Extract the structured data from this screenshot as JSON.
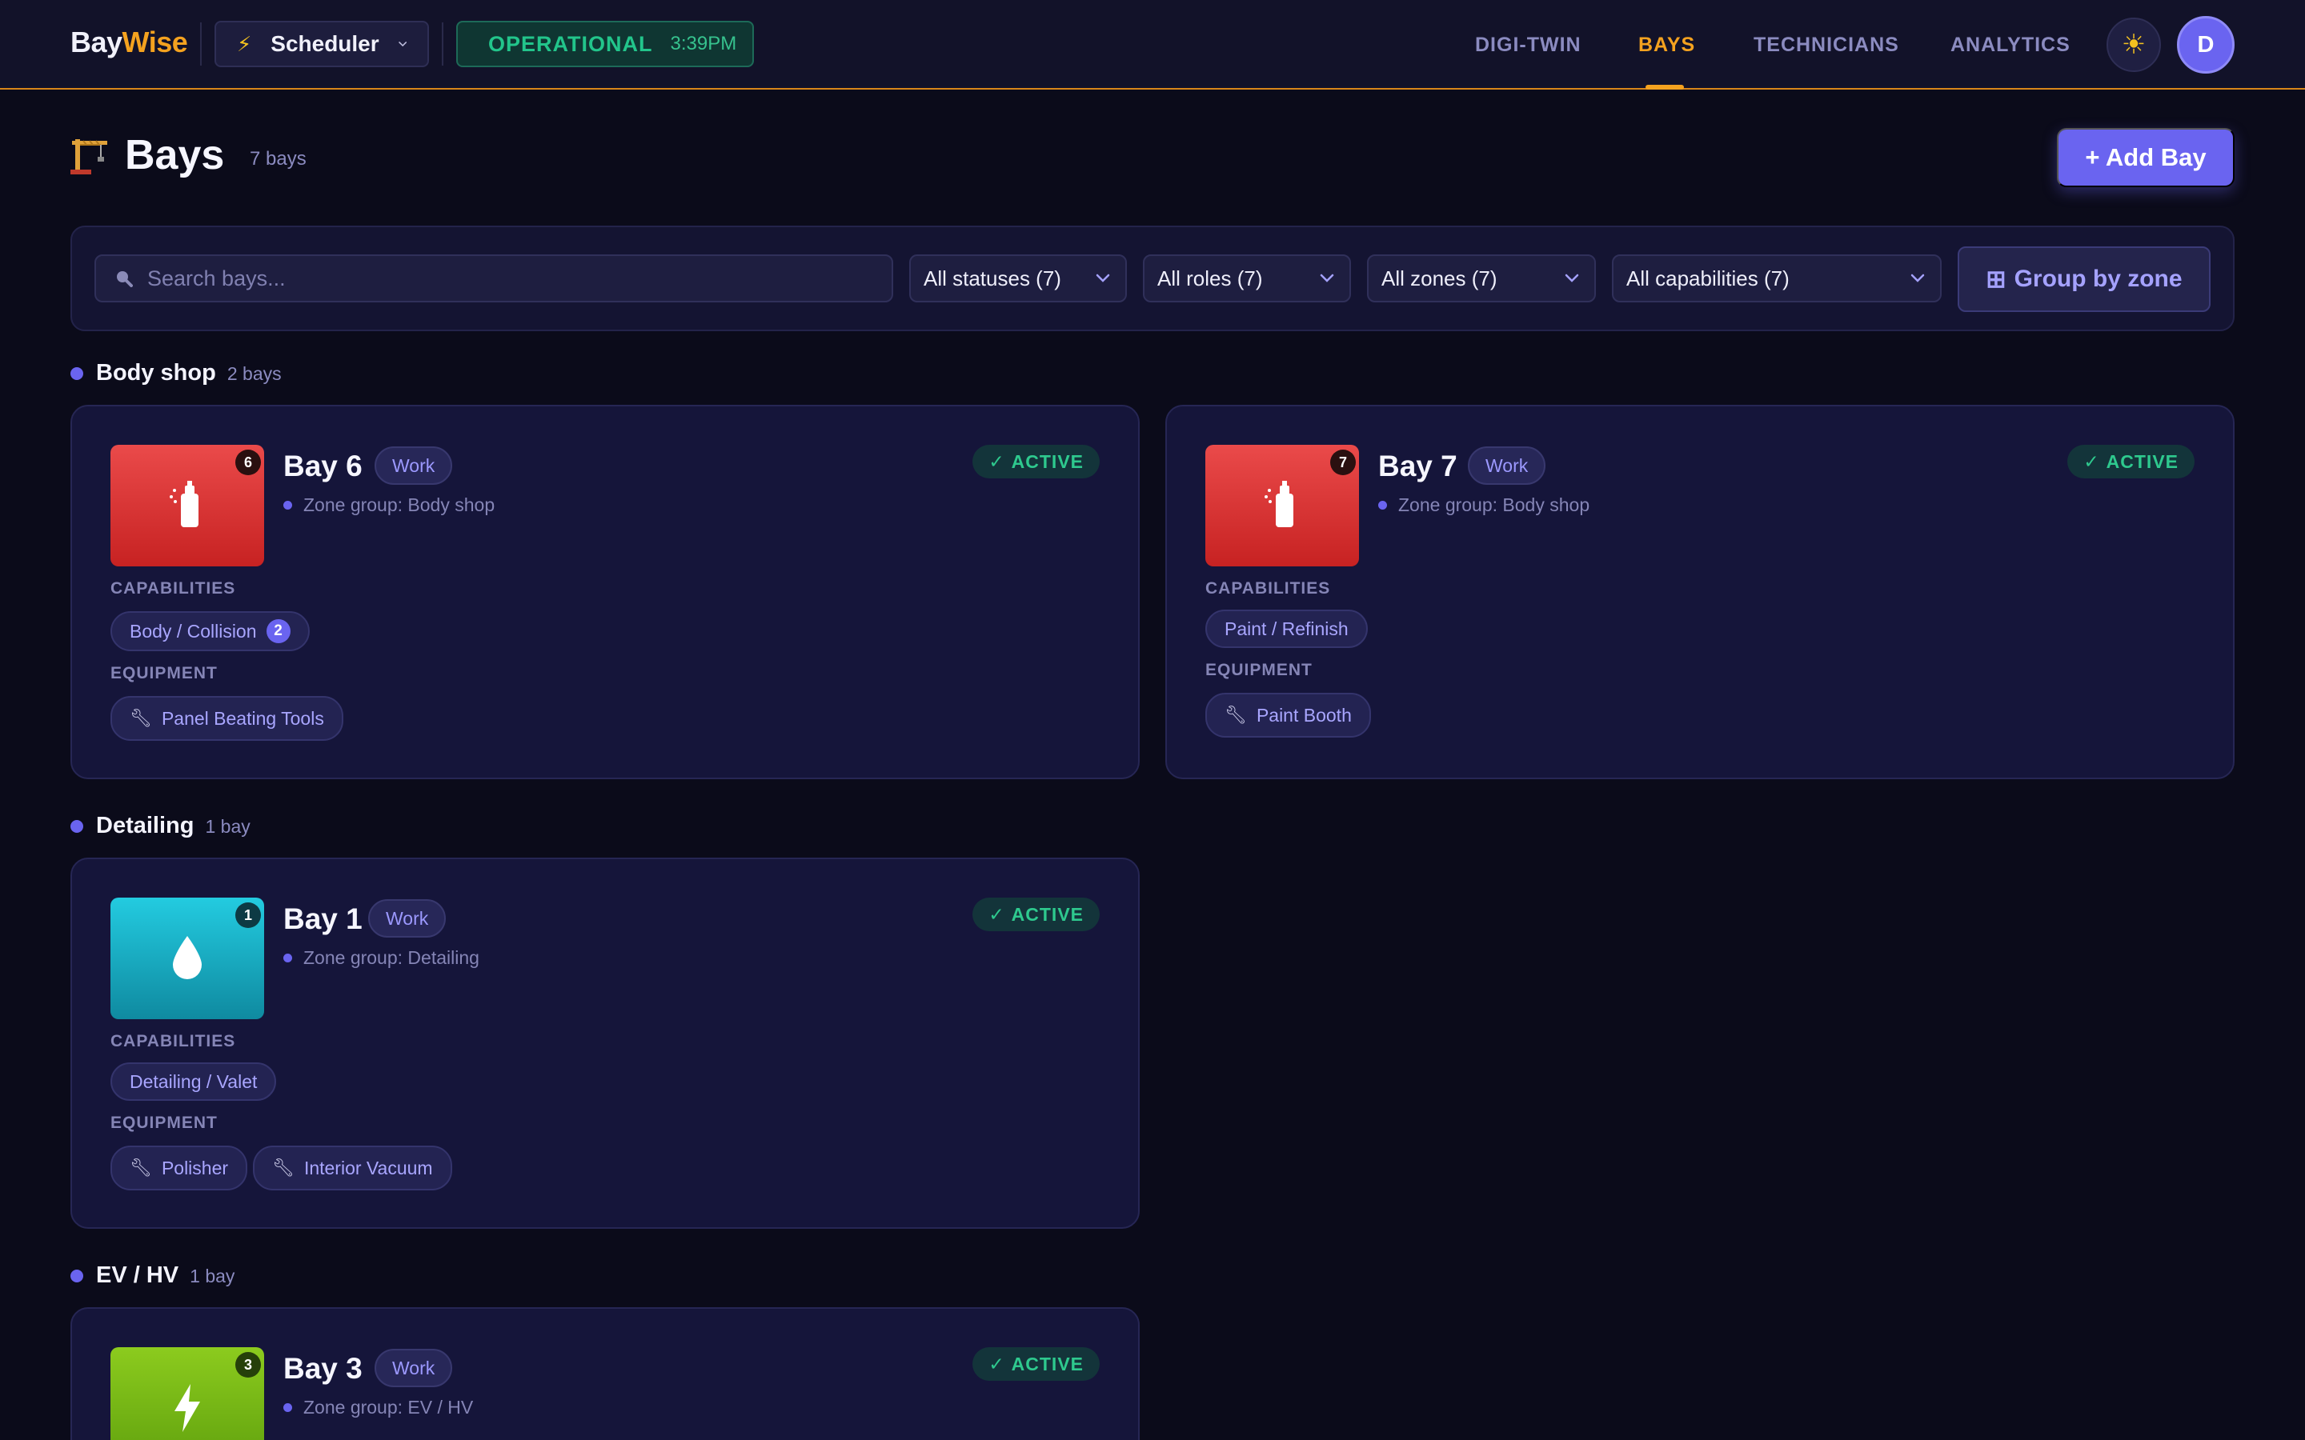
{
  "brand": {
    "part1": "Bay",
    "part2": "Wise"
  },
  "scheduler": {
    "label": "Scheduler"
  },
  "status": {
    "label": "OPERATIONAL",
    "time": "3:39PM"
  },
  "nav": {
    "digital_twin": "DIGI-TWIN",
    "bays": "BAYS",
    "technicians": "TECHNICIANS",
    "analytics": "ANALYTICS"
  },
  "user": {
    "initial": "D"
  },
  "page": {
    "title": "Bays",
    "count": "7 bays",
    "add_button": "+ Add Bay"
  },
  "filters": {
    "search_placeholder": "Search bays...",
    "statuses": "All statuses (7)",
    "roles": "All roles (7)",
    "zones": "All zones (7)",
    "capabilities": "All capabilities (7)",
    "group_button": "Group by zone"
  },
  "labels": {
    "capabilities": "CAPABILITIES",
    "equipment": "EQUIPMENT",
    "active": "ACTIVE"
  },
  "sections": [
    {
      "title": "Body shop",
      "count": "2 bays"
    },
    {
      "title": "Detailing",
      "count": "1 bay"
    },
    {
      "title": "EV / HV",
      "count": "1 bay"
    }
  ],
  "bays": {
    "bay6": {
      "name": "Bay 6",
      "num": "6",
      "role": "Work",
      "zone": "Zone group: Body shop",
      "capability": "Body / Collision",
      "capability_count": "2",
      "equipment": [
        "Panel Beating Tools"
      ]
    },
    "bay7": {
      "name": "Bay 7",
      "num": "7",
      "role": "Work",
      "zone": "Zone group: Body shop",
      "capability": "Paint / Refinish",
      "equipment": [
        "Paint Booth"
      ]
    },
    "bay1": {
      "name": "Bay 1",
      "num": "1",
      "role": "Work",
      "zone": "Zone group: Detailing",
      "capability": "Detailing / Valet",
      "equipment": [
        "Polisher",
        "Interior Vacuum"
      ]
    },
    "bay3": {
      "name": "Bay 3",
      "num": "3",
      "role": "Work",
      "zone": "Zone group: EV / HV"
    }
  },
  "colors": {
    "accent": "#6a64f0",
    "brand_orange": "#f4a21f",
    "success": "#22c58b",
    "bg": "#0b0b1a",
    "card": "#15153a"
  }
}
